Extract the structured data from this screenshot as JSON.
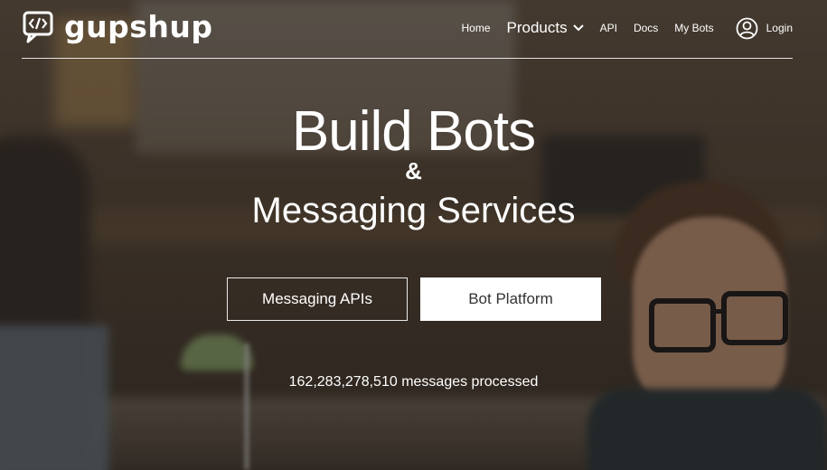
{
  "brand": {
    "name": "gupshup",
    "logo_icon": "code-chat-bubble-icon"
  },
  "nav": {
    "home": "Home",
    "products": "Products",
    "api": "API",
    "docs": "Docs",
    "my_bots": "My Bots",
    "login": "Login"
  },
  "hero": {
    "title_line1": "Build Bots",
    "ampersand": "&",
    "title_line2": "Messaging Services"
  },
  "buttons": {
    "messaging_apis": "Messaging APIs",
    "bot_platform": "Bot Platform"
  },
  "stats": {
    "messages_processed": "162,283,278,510 messages processed"
  },
  "colors": {
    "text": "#ffffff",
    "button_solid_bg": "#ffffff",
    "button_solid_text": "#333333"
  }
}
